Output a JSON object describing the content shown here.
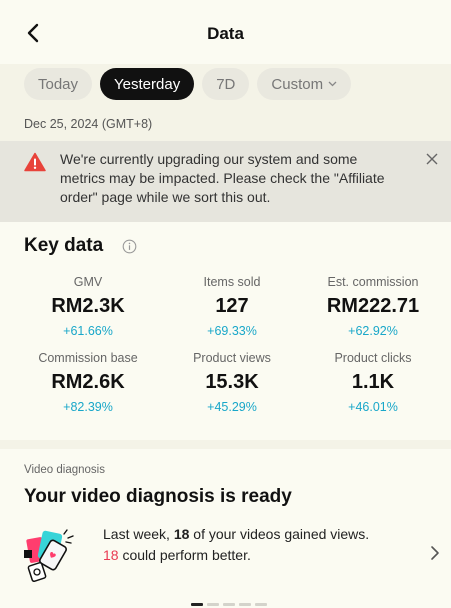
{
  "header": {
    "title": "Data",
    "back_icon": "chevron-left-icon"
  },
  "tabs": [
    {
      "label": "Today",
      "active": false
    },
    {
      "label": "Yesterday",
      "active": true
    },
    {
      "label": "7D",
      "active": false
    },
    {
      "label": "Custom",
      "active": false,
      "has_dropdown": true
    }
  ],
  "date_range": "Dec 25, 2024 (GMT+8)",
  "banner": {
    "icon": "warning-triangle-icon",
    "text": "We're currently upgrading our system and some metrics may be impacted. Please check the \"Affiliate order\" page while we sort this out.",
    "close_icon": "close-icon"
  },
  "key_data": {
    "title": "Key data",
    "metrics": [
      {
        "label": "GMV",
        "value": "RM2.3K",
        "change": "+61.66%"
      },
      {
        "label": "Items sold",
        "value": "127",
        "change": "+69.33%"
      },
      {
        "label": "Est. commission",
        "value": "RM222.71",
        "change": "+62.92%"
      },
      {
        "label": "Commission base",
        "value": "RM2.6K",
        "change": "+82.39%"
      },
      {
        "label": "Product views",
        "value": "15.3K",
        "change": "+45.29%"
      },
      {
        "label": "Product clicks",
        "value": "1.1K",
        "change": "+46.01%"
      }
    ]
  },
  "video_diagnosis": {
    "section_label": "Video diagnosis",
    "title": "Your video diagnosis is ready",
    "text_part1": "Last week, ",
    "count_viewed": "18",
    "text_part2": " of your videos gained views.",
    "count_better": "18",
    "text_part3": " could perform better."
  },
  "pagination": {
    "total": 5,
    "active_index": 0
  },
  "colors": {
    "accent_change": "#19a7c9",
    "highlight_red": "#e93a52",
    "warning_red": "#e8433a"
  }
}
